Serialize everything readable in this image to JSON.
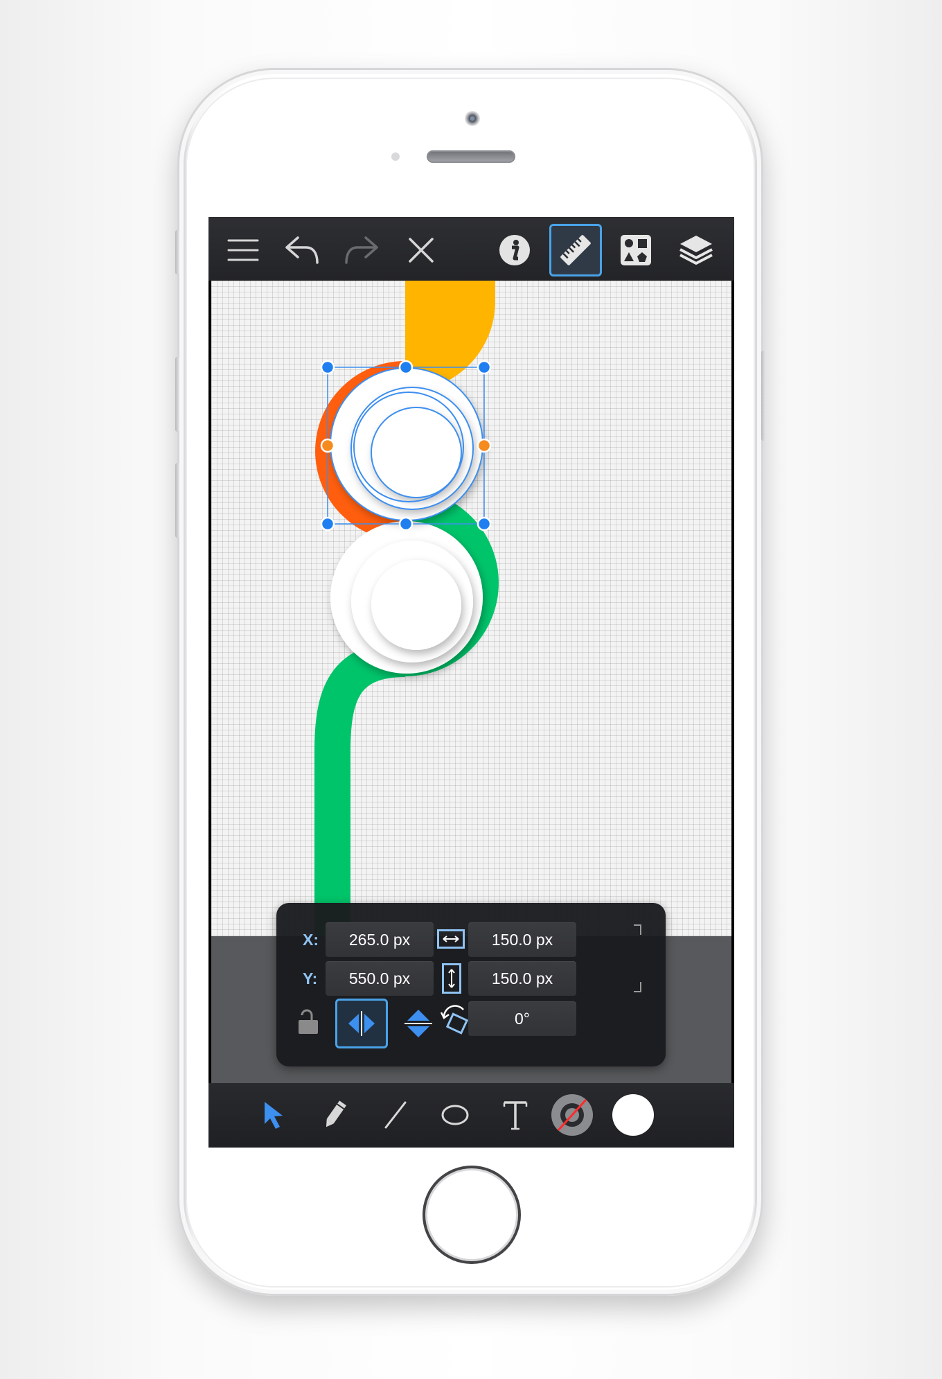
{
  "app": {
    "toolbar": {
      "icons": [
        "menu-icon",
        "undo-icon",
        "redo-icon",
        "close-icon",
        "info-icon",
        "ruler-icon",
        "shapes-library-icon",
        "layers-icon"
      ],
      "active": "ruler-icon"
    },
    "tools": {
      "icons": [
        "select-arrow-icon",
        "pencil-icon",
        "line-icon",
        "ellipse-icon",
        "text-icon",
        "stroke-color-swatch",
        "fill-color-swatch"
      ],
      "active": "select-arrow-icon",
      "stroke_color": "none",
      "fill_color": "#ffffff"
    },
    "inspector": {
      "x_label": "X:",
      "x_value": "265.0 px",
      "y_label": "Y:",
      "y_value": "550.0 px",
      "width_value": "150.0 px",
      "height_value": "150.0 px",
      "rotation_value": "0°",
      "lock_state": "unlocked",
      "flip_horizontal_active": true
    },
    "colors": {
      "accent": "#3d8ff0",
      "selection_handle": "#1f7ff0",
      "rotation_handle": "#f58a1f",
      "shape_yellow": "#ffb400",
      "shape_orange": "#ff5e0e",
      "shape_green": "#00c46a"
    }
  }
}
